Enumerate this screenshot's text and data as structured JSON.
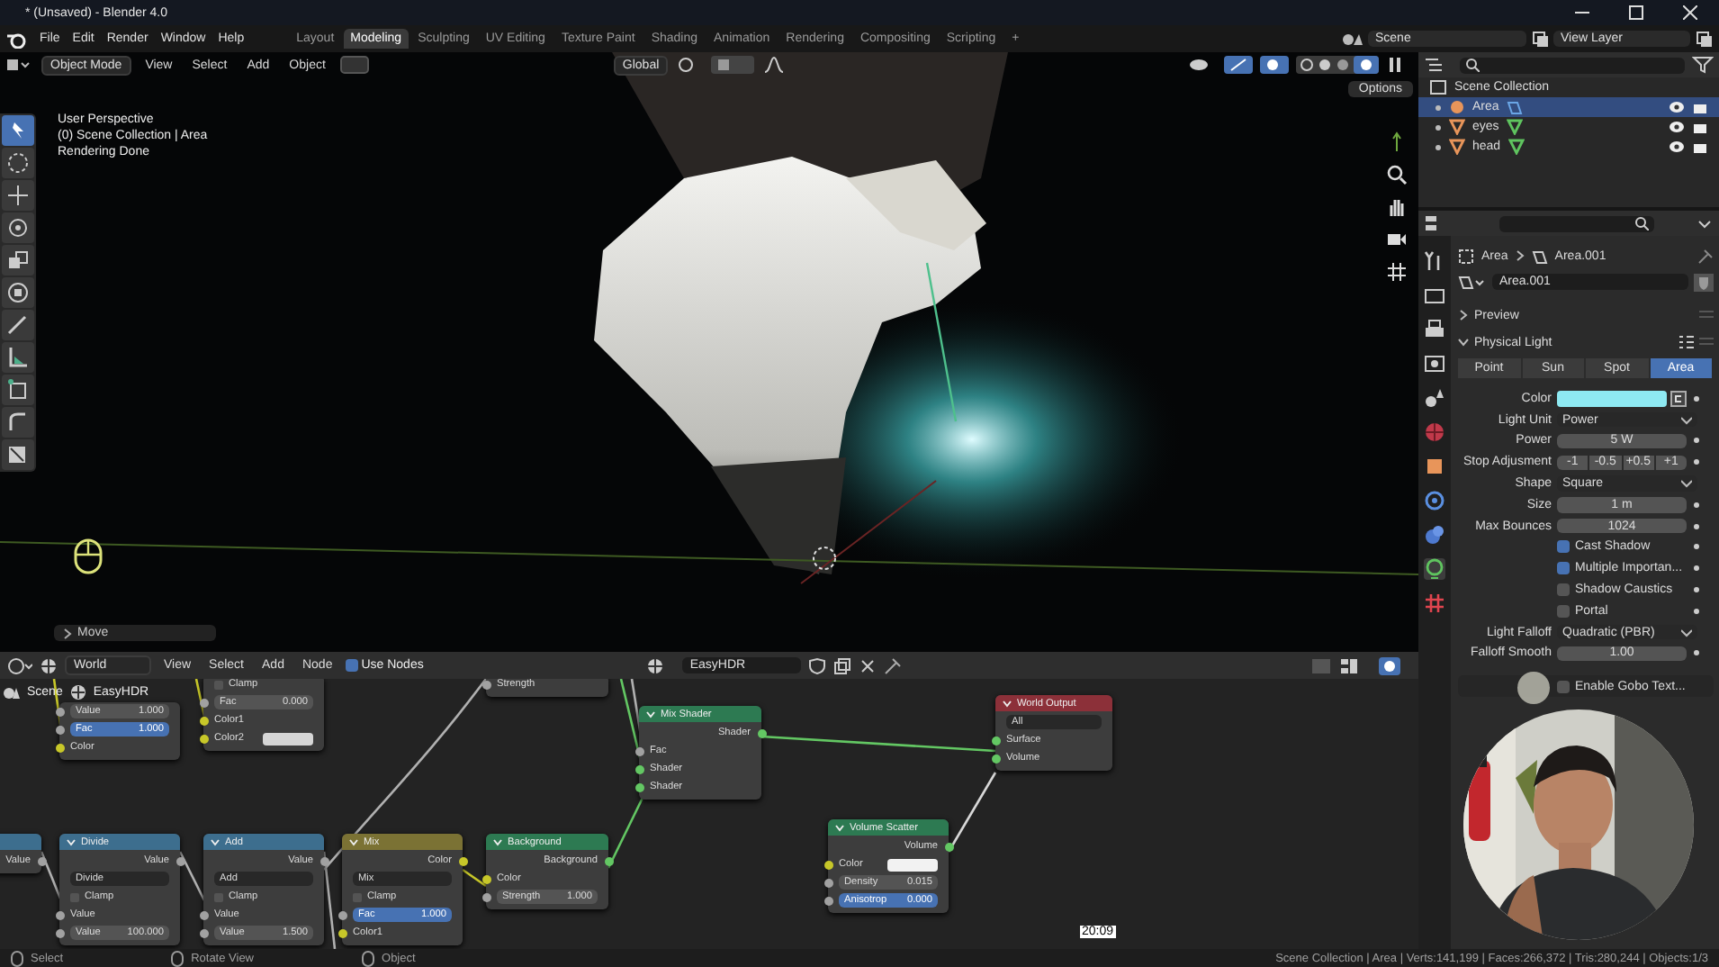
{
  "window": {
    "title": "* (Unsaved) - Blender 4.0"
  },
  "menu": [
    "File",
    "Edit",
    "Render",
    "Window",
    "Help"
  ],
  "workspaces": [
    {
      "label": "Layout",
      "selected": false
    },
    {
      "label": "Modeling",
      "selected": true
    },
    {
      "label": "Sculpting",
      "selected": false
    },
    {
      "label": "UV Editing",
      "selected": false
    },
    {
      "label": "Texture Paint",
      "selected": false
    },
    {
      "label": "Shading",
      "selected": false
    },
    {
      "label": "Animation",
      "selected": false
    },
    {
      "label": "Rendering",
      "selected": false
    },
    {
      "label": "Compositing",
      "selected": false
    },
    {
      "label": "Scripting",
      "selected": false
    }
  ],
  "add_workspace": "+",
  "scene": "Scene",
  "view_layer": "View Layer",
  "viewport": {
    "mode": "Object Mode",
    "menus": [
      "View",
      "Select",
      "Add",
      "Object"
    ],
    "orientation": "Global",
    "options": "Options",
    "overlay_lines": [
      "User Perspective",
      "(0) Scene Collection | Area",
      "Rendering Done"
    ],
    "last_operator": "Move"
  },
  "node_editor": {
    "type": "World",
    "menus": [
      "View",
      "Select",
      "Add",
      "Node"
    ],
    "use_nodes": {
      "label": "Use Nodes",
      "checked": true
    },
    "world_name": "EasyHDR",
    "breadcrumbs": [
      "Scene",
      "EasyHDR"
    ],
    "timestamp": "20:09",
    "nodes": [
      {
        "rows": [
          {
            "kind": "value",
            "label": "Value",
            "value": "1.000",
            "color": "#a1a1a1"
          },
          {
            "kind": "slider",
            "label": "Fac",
            "value": "1.000",
            "color": "#a1a1a1"
          },
          {
            "kind": "input",
            "label": "Color",
            "color": "#c7c729"
          }
        ]
      },
      {
        "rows": [
          {
            "kind": "checkbox",
            "label": "Clamp",
            "checked": false
          },
          {
            "kind": "value",
            "label": "Fac",
            "value": "0.000",
            "color": "#a1a1a1"
          },
          {
            "kind": "input",
            "label": "Color1",
            "color": "#c7c729"
          },
          {
            "kind": "color",
            "label": "Color2",
            "color": "#d6d6d6"
          }
        ]
      },
      {
        "rows": [
          {
            "kind": "input",
            "label": "Strength",
            "color": "#a1a1a1"
          }
        ]
      },
      {
        "title": "Mix Shader",
        "kind": "shader",
        "rows": [
          {
            "kind": "output",
            "label": "Shader",
            "color": "#63c763"
          },
          {
            "kind": "input",
            "label": "Fac",
            "color": "#a1a1a1"
          },
          {
            "kind": "input",
            "label": "Shader",
            "color": "#63c763"
          },
          {
            "kind": "input",
            "label": "Shader",
            "color": "#63c763"
          }
        ]
      },
      {
        "title": "World Output",
        "kind": "output",
        "rows": [
          {
            "kind": "dropdown",
            "value": "All"
          },
          {
            "kind": "input",
            "label": "Surface",
            "color": "#63c763"
          },
          {
            "kind": "input",
            "label": "Volume",
            "color": "#63c763"
          }
        ]
      },
      {
        "kind": "converter",
        "rows": [
          {
            "kind": "output",
            "label": "Value",
            "color": "#a1a1a1"
          }
        ]
      },
      {
        "title": "Divide",
        "kind": "converter",
        "rows": [
          {
            "kind": "output",
            "label": "Value",
            "color": "#a1a1a1"
          },
          {
            "kind": "dropdown",
            "value": "Divide"
          },
          {
            "kind": "checkbox",
            "label": "Clamp",
            "checked": false
          },
          {
            "kind": "input",
            "label": "Value",
            "color": "#a1a1a1"
          },
          {
            "kind": "value",
            "label": "Value",
            "value": "100.000",
            "color": "#a1a1a1"
          }
        ]
      },
      {
        "title": "Add",
        "kind": "converter",
        "rows": [
          {
            "kind": "output",
            "label": "Value",
            "color": "#a1a1a1"
          },
          {
            "kind": "dropdown",
            "value": "Add"
          },
          {
            "kind": "checkbox",
            "label": "Clamp",
            "checked": false
          },
          {
            "kind": "input",
            "label": "Value",
            "color": "#a1a1a1"
          },
          {
            "kind": "value",
            "label": "Value",
            "value": "1.500",
            "color": "#a1a1a1"
          }
        ]
      },
      {
        "title": "Mix",
        "kind": "color",
        "rows": [
          {
            "kind": "output",
            "label": "Color",
            "color": "#c7c729"
          },
          {
            "kind": "dropdown",
            "value": "Mix"
          },
          {
            "kind": "checkbox",
            "label": "Clamp",
            "checked": false
          },
          {
            "kind": "slider",
            "label": "Fac",
            "value": "1.000",
            "color": "#a1a1a1"
          },
          {
            "kind": "input",
            "label": "Color1",
            "color": "#c7c729"
          }
        ]
      },
      {
        "title": "Background",
        "kind": "shader",
        "rows": [
          {
            "kind": "output",
            "label": "Background",
            "color": "#63c763"
          },
          {
            "kind": "input",
            "label": "Color",
            "color": "#c7c729"
          },
          {
            "kind": "value",
            "label": "Strength",
            "value": "1.000",
            "color": "#a1a1a1"
          }
        ]
      },
      {
        "title": "Volume Scatter",
        "kind": "shader",
        "rows": [
          {
            "kind": "output",
            "label": "Volume",
            "color": "#63c763"
          },
          {
            "kind": "color",
            "label": "Color",
            "color": "#f2f2f2"
          },
          {
            "kind": "value",
            "label": "Density",
            "value": "0.015",
            "color": "#a1a1a1"
          },
          {
            "kind": "slider",
            "label": "Anisotrop",
            "value": "0.000",
            "color": "#a1a1a1"
          }
        ]
      }
    ]
  },
  "outliner": {
    "root": "Scene Collection",
    "items": [
      {
        "name": "Area",
        "kind": "light",
        "selected": true
      },
      {
        "name": "eyes",
        "kind": "mesh",
        "selected": false
      },
      {
        "name": "head",
        "kind": "mesh",
        "selected": false
      }
    ]
  },
  "properties": {
    "breadcrumb": [
      "Area",
      "Area.001"
    ],
    "datablock": "Area.001",
    "panels": [
      {
        "label": "Preview",
        "expanded": false
      },
      {
        "label": "Physical Light",
        "expanded": true
      }
    ],
    "light_types": [
      {
        "label": "Point",
        "selected": false
      },
      {
        "label": "Sun",
        "selected": false
      },
      {
        "label": "Spot",
        "selected": false
      },
      {
        "label": "Area",
        "selected": true
      }
    ],
    "rows": [
      {
        "kind": "color",
        "label": "Color",
        "color": "#8ee9f2"
      },
      {
        "kind": "dropdown",
        "label": "Light Unit",
        "value": "Power"
      },
      {
        "kind": "number",
        "label": "Power",
        "value": "5 W"
      },
      {
        "kind": "buttons",
        "label": "Stop Adjusment",
        "buttons": [
          "-1",
          "-0.5",
          "+0.5",
          "+1"
        ]
      },
      {
        "kind": "dropdown",
        "label": "Shape",
        "value": "Square"
      },
      {
        "kind": "number",
        "label": "Size",
        "value": "1 m"
      },
      {
        "kind": "number",
        "label": "Max Bounces",
        "value": "1024"
      },
      {
        "kind": "checkbox",
        "label": "Cast Shadow",
        "checked": true
      },
      {
        "kind": "checkbox",
        "label": "Multiple Importan...",
        "checked": true
      },
      {
        "kind": "checkbox",
        "label": "Shadow Caustics",
        "checked": false
      },
      {
        "kind": "checkbox",
        "label": "Portal",
        "checked": false
      },
      {
        "kind": "dropdown",
        "label": "Light Falloff",
        "value": "Quadratic (PBR)"
      },
      {
        "kind": "number",
        "label": "Falloff Smooth",
        "value": "1.00"
      },
      {
        "kind": "subpanel",
        "label": "Enable Gobo Text...",
        "checked": false
      }
    ]
  },
  "status_bar": {
    "hints": [
      "Select",
      "Rotate View",
      "Object"
    ],
    "stats": "Scene Collection | Area | Verts:141,199 | Faces:266,372 | Tris:280,244 | Objects:1/3"
  }
}
